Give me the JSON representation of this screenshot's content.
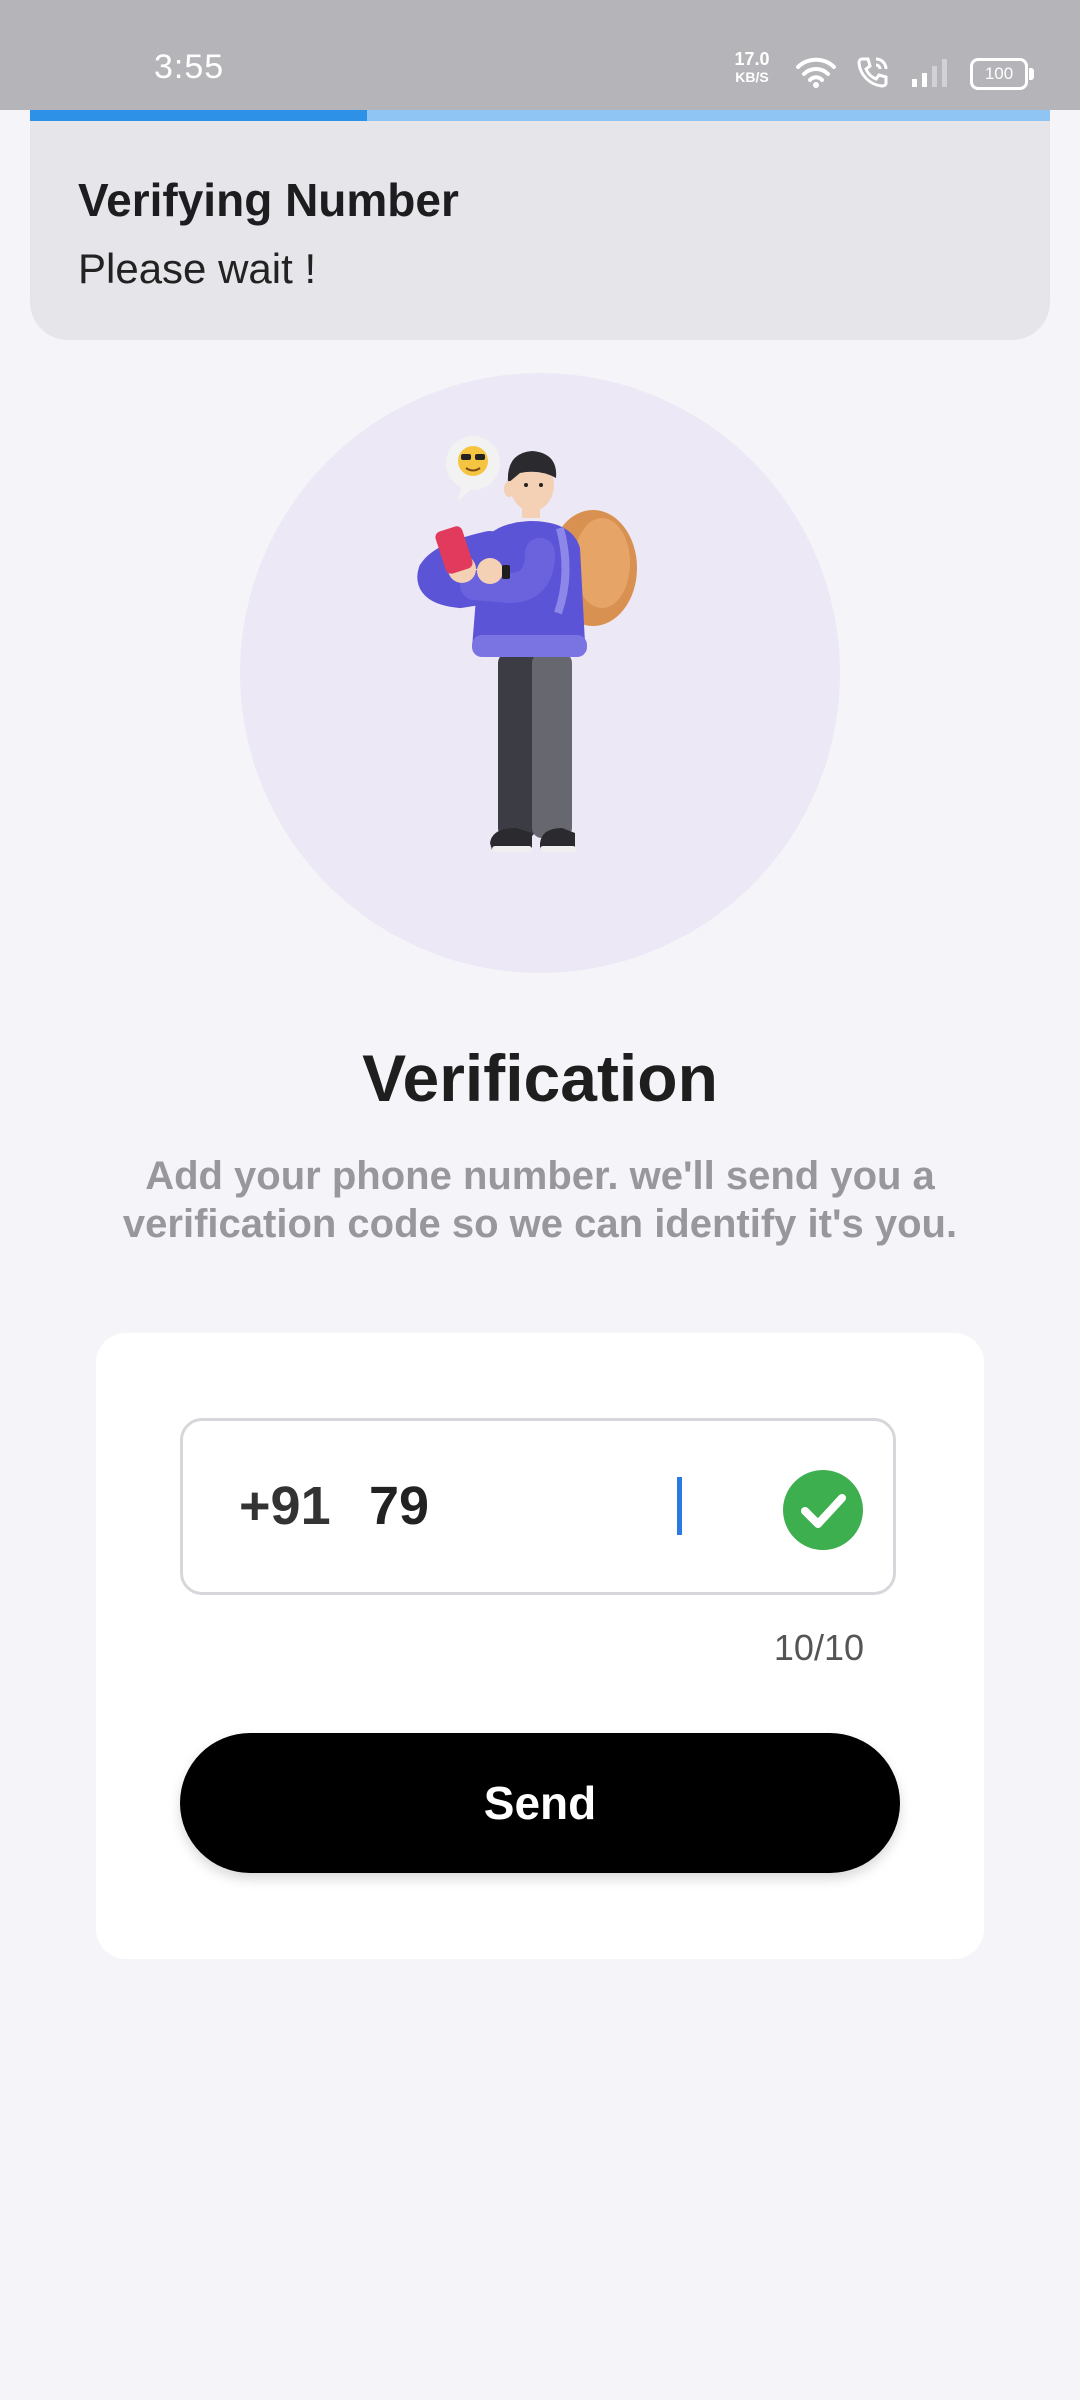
{
  "status_bar": {
    "time": "3:55",
    "net_speed_value": "17.0",
    "net_speed_unit": "KB/S",
    "battery": "100"
  },
  "progress": {
    "fraction": 0.33
  },
  "toast": {
    "title": "Verifying Number",
    "message": "Please wait !"
  },
  "main": {
    "title": "Verification",
    "subtitle": "Add your phone number. we'll send you a verification code so we can identify it's you."
  },
  "form": {
    "country_code": "+91",
    "phone_value": "79",
    "counter": "10/10",
    "send_label": "Send"
  },
  "colors": {
    "accent": "#2d91e8",
    "success": "#3daf4e",
    "button": "#000000"
  }
}
